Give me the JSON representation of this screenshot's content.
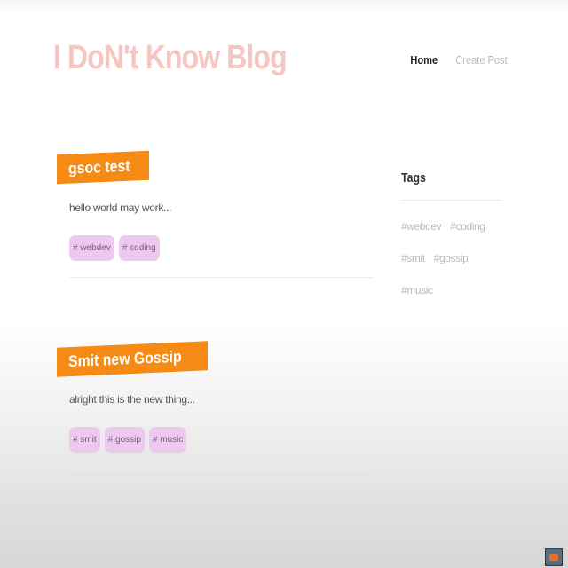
{
  "site": {
    "brand": "I DoN't Know Blog"
  },
  "nav": {
    "home": "Home",
    "create_post": "Create Post"
  },
  "posts": [
    {
      "title": "gsoc test",
      "excerpt": "hello world may work...",
      "tags": [
        "# webdev",
        "# coding"
      ]
    },
    {
      "title": "Smit new Gossip",
      "excerpt": "alright this is the new thing...",
      "tags": [
        "# smit",
        "# gossip",
        "# music"
      ]
    }
  ],
  "sidebar": {
    "title": "Tags",
    "tags": [
      "#webdev",
      "#coding",
      "#smit",
      "#gossip",
      "#music"
    ]
  },
  "colors": {
    "brand": "#f5c6c2",
    "post_title_bg": "#f58a14",
    "tag_bg": "#eec9ef"
  }
}
